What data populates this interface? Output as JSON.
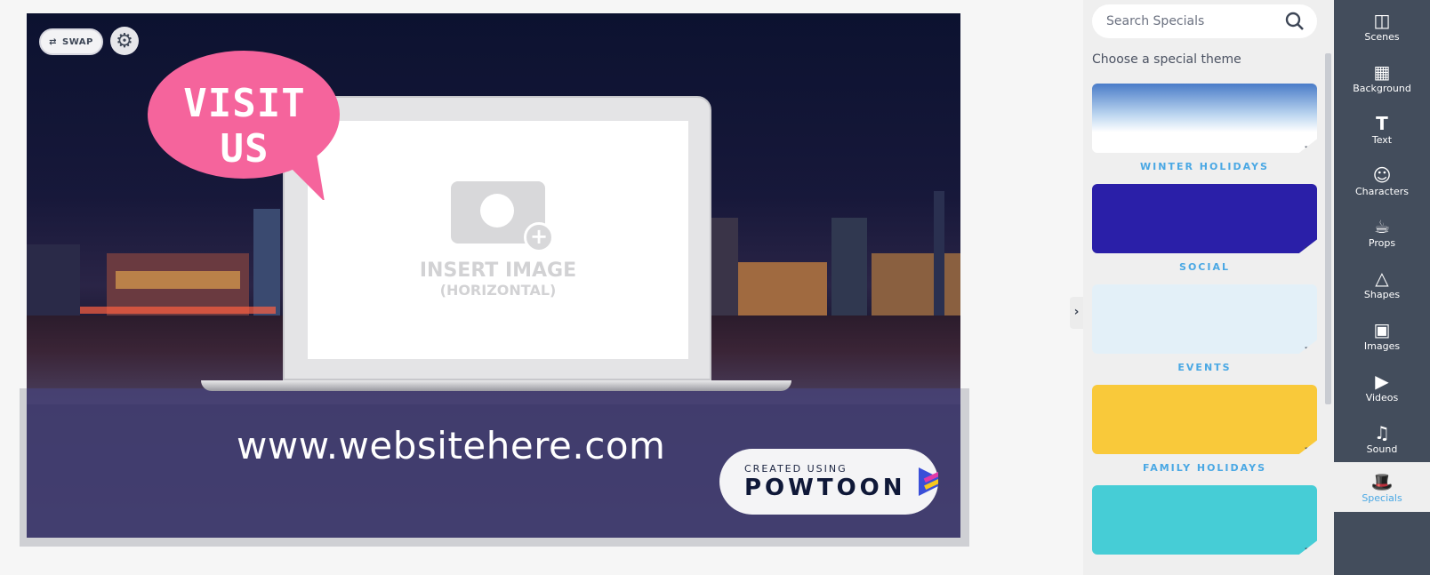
{
  "stage": {
    "swap_label": "SWAP",
    "bubble_text": "VISIT US",
    "insert_image_line1": "INSERT IMAGE",
    "insert_image_line2": "(HORIZONTAL)",
    "url_text": "www.websitehere.com",
    "watermark": {
      "line1": "CREATED USING",
      "line2": "POWTOON"
    },
    "colors": {
      "bubble": "#f5649c",
      "band": "#46427a"
    }
  },
  "panel": {
    "search_placeholder": "Search Specials",
    "title": "Choose a special theme",
    "themes": [
      {
        "label": "WINTER HOLIDAYS",
        "color": "#c8def2"
      },
      {
        "label": "SOCIAL",
        "color": "#2a1fa8"
      },
      {
        "label": "EVENTS",
        "color": "#e3f0f8"
      },
      {
        "label": "FAMILY HOLIDAYS",
        "color": "#f9c93a"
      },
      {
        "label": "",
        "color": "#46cdd6"
      }
    ]
  },
  "nav": {
    "items": [
      {
        "label": "Scenes",
        "icon": "layout-icon"
      },
      {
        "label": "Background",
        "icon": "checker-icon"
      },
      {
        "label": "Text",
        "icon": "text-icon"
      },
      {
        "label": "Characters",
        "icon": "people-icon"
      },
      {
        "label": "Props",
        "icon": "briefcase-cup-icon"
      },
      {
        "label": "Shapes",
        "icon": "shapes-icon"
      },
      {
        "label": "Images",
        "icon": "images-icon"
      },
      {
        "label": "Videos",
        "icon": "play-icon"
      },
      {
        "label": "Sound",
        "icon": "music-icon"
      },
      {
        "label": "Specials",
        "icon": "magic-hat-icon",
        "active": true
      }
    ],
    "accent": "#4aa8e4"
  }
}
